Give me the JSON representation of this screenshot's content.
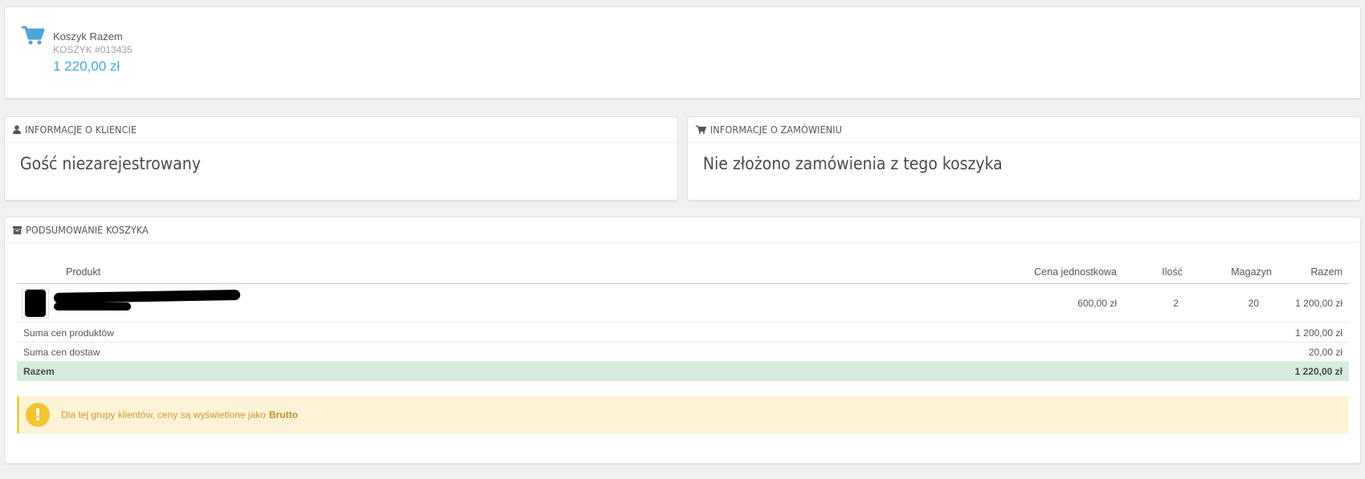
{
  "cart_header": {
    "title": "Koszyk Razem",
    "cart_id": "KOSZYK #013435",
    "total": "1 220,00 zł",
    "icon": "shopping-cart-icon",
    "accent_color": "#4aa6d6"
  },
  "customer_panel": {
    "heading": "INFORMACJE O KLIENCIE",
    "icon": "user-icon",
    "text": "Gość niezarejestrowany"
  },
  "order_panel": {
    "heading": "INFORMACJE O ZAMÓWIENIU",
    "icon": "shopping-cart-icon",
    "text": "Nie złożono zamówienia z tego koszyka"
  },
  "summary_panel": {
    "heading": "PODSUMOWANIE KOSZYKA",
    "icon": "archive-icon",
    "columns": {
      "product": "Produkt",
      "unit_price": "Cena jednostkowa",
      "quantity": "Ilość",
      "stock": "Magazyn",
      "total": "Razem"
    },
    "product_row": {
      "unit_price": "600,00 zł",
      "quantity": "2",
      "stock": "20",
      "total": "1 200,00 zł"
    },
    "sum_products": {
      "label": "Suma cen produktów",
      "value": "1 200,00 zł"
    },
    "sum_shipping": {
      "label": "Suma cen dostaw",
      "value": "20,00 zł"
    },
    "grand_total": {
      "label": "Razem",
      "value": "1 220,00 zł"
    },
    "alert": {
      "text": "Dla tej grupy klientów, ceny są wyświetlone jako",
      "emphasis": "Brutto",
      "icon": "exclamation-icon",
      "colors": {
        "background": "#fff3d7",
        "border": "#f2c94c",
        "text": "#c99a2e"
      }
    },
    "total_row_color": "#d6ebdd"
  }
}
